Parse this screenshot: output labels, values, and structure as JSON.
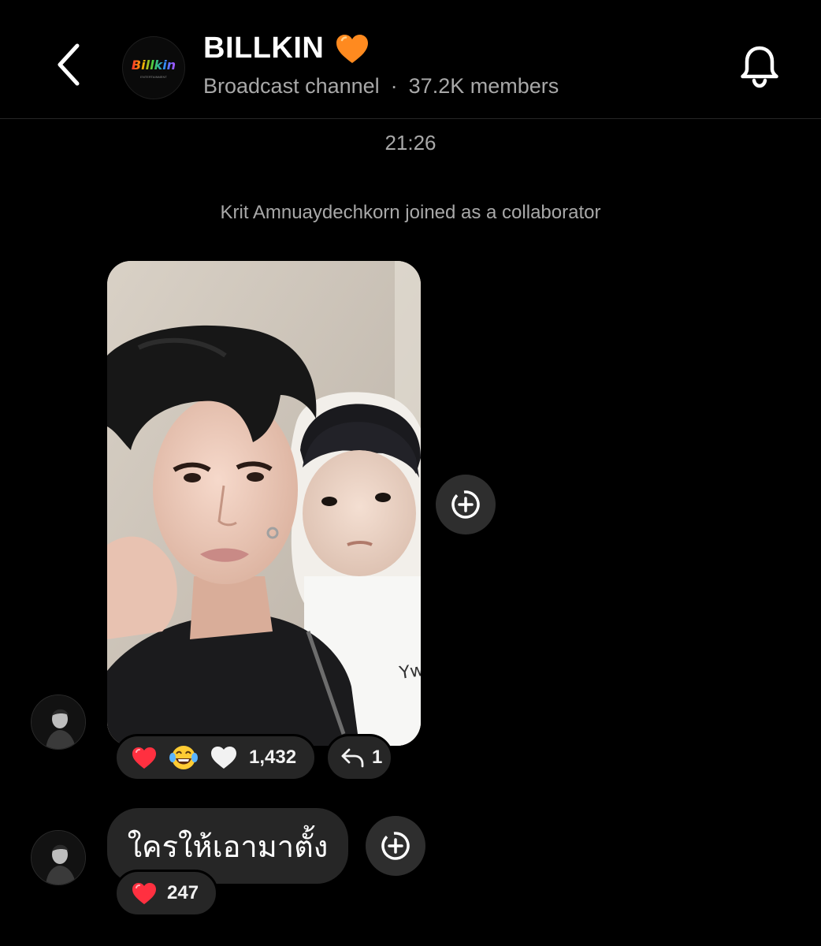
{
  "header": {
    "channel_name": "BILLKIN",
    "channel_emoji": "🧡",
    "channel_type": "Broadcast channel",
    "members": "37.2K members",
    "avatar_logo_text": "Billkin",
    "avatar_sub_text": "ENTERTAINMENT"
  },
  "feed": {
    "timestamp": "21:26",
    "system_message": "Krit Amnuaydechkorn joined as a collaborator",
    "messages": [
      {
        "type": "photo",
        "reactions": {
          "emojis": [
            "❤️",
            "😂",
            "🤍"
          ],
          "count": "1,432"
        },
        "replies": {
          "count": "1"
        }
      },
      {
        "type": "text",
        "text": "ใครให้เอามาตั้ง",
        "reactions": {
          "emojis": [
            "❤️"
          ],
          "count": "247"
        }
      }
    ]
  },
  "icons": {
    "back": "chevron-left-icon",
    "bell": "bell-icon",
    "share": "share-plus-icon",
    "reply": "reply-arrow-icon"
  },
  "colors": {
    "background": "#000000",
    "bubble": "#262626",
    "secondary_text": "#a8a8a8",
    "heart": "#ff3040",
    "orange_heart": "#ff8a1f"
  }
}
